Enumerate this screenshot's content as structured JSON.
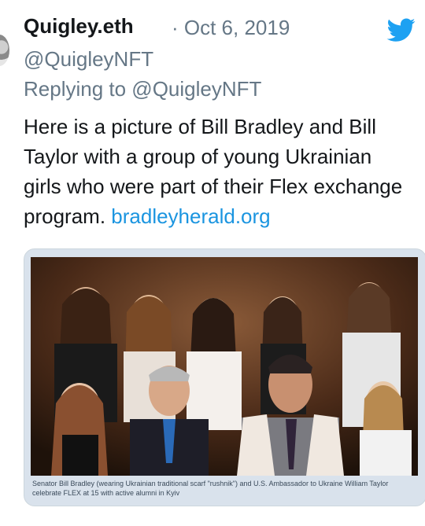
{
  "tweet": {
    "author_name": "Quigley.eth",
    "date": "· Oct 6, 2019",
    "handle": "@QuigleyNFT",
    "replying_to": "Replying to @QuigleyNFT",
    "text": "Here is a picture of Bill Bradley and Bill Taylor with a group of young Ukrainian girls who were part of their Flex exchange program.",
    "link": "bradleyherald.org"
  },
  "media": {
    "caption": "Senator Bill Bradley (wearing Ukrainian traditional scarf \"rushnik\") and U.S. Ambassador to Ukraine William Taylor celebrate FLEX at 15 with active alumni in Kyiv"
  },
  "icons": {
    "brand": "twitter-bird-icon"
  },
  "colors": {
    "accent": "#1da1f2",
    "link": "#1b95e0",
    "muted": "#657786"
  }
}
